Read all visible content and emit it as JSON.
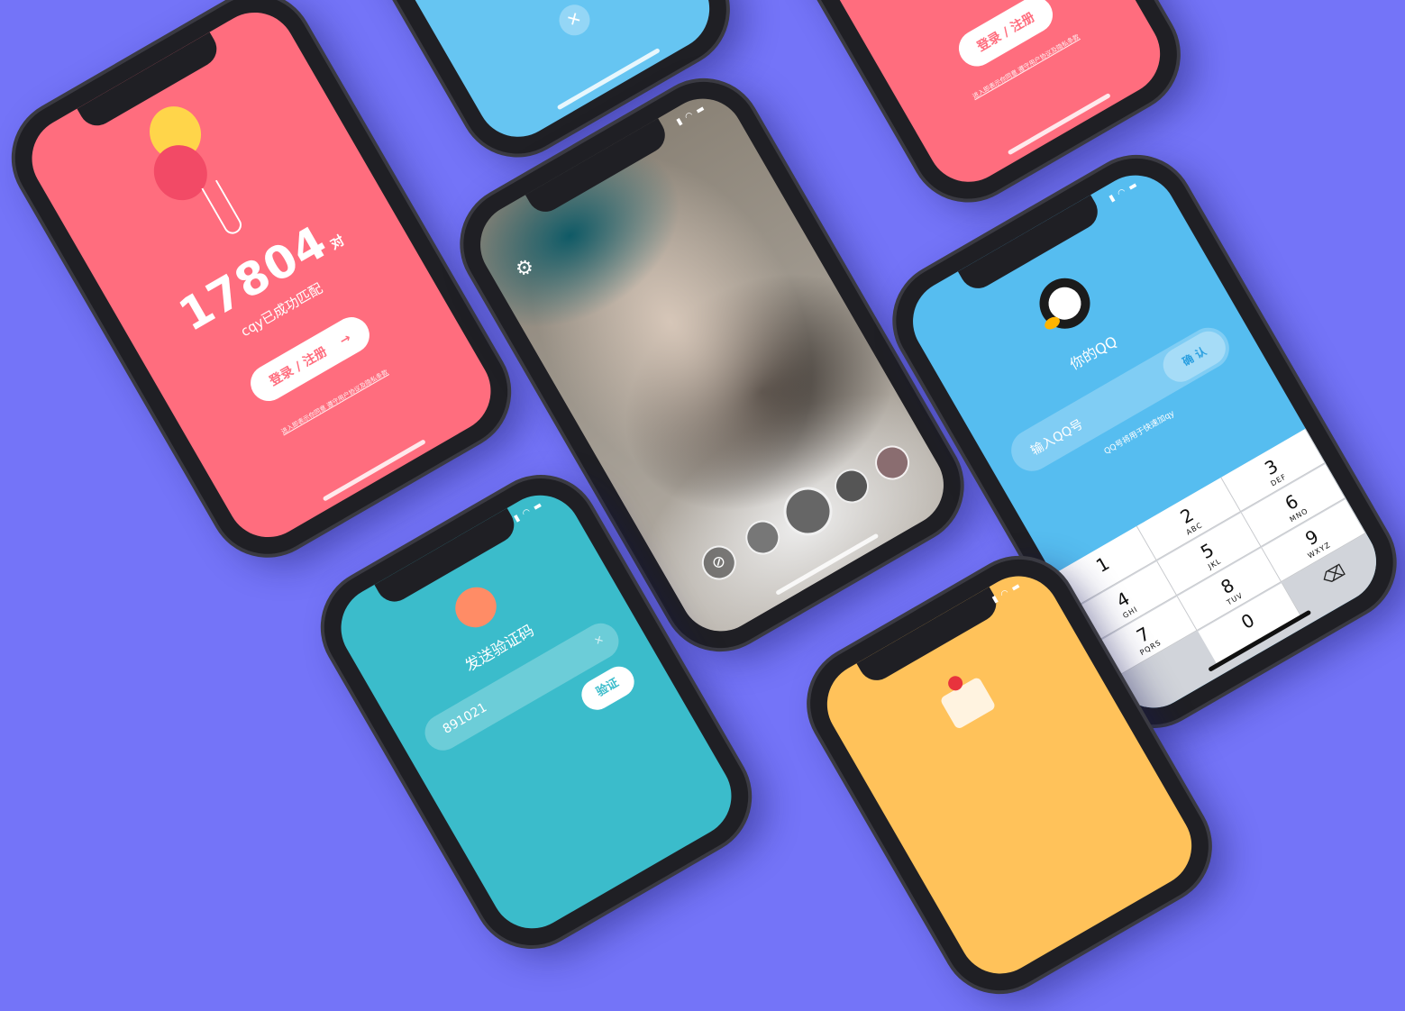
{
  "colors": {
    "background": "#7474f8",
    "pink": "#ff6d7e",
    "sky": "#66c5f2",
    "qq_blue": "#56bdf0",
    "teal": "#3bbccb",
    "yellow": "#ffc25a"
  },
  "pink_phone": {
    "count": "17804",
    "count_unit": "对",
    "subtitle": "cqy已成功匹配",
    "login_button": "登录 / 注册",
    "arrow_icon": "→",
    "terms_link": "进入即表示你同意 遵守用户协议及隐私条款"
  },
  "blue_top_phone": {
    "close_icon": "✕"
  },
  "pink_top_phone": {
    "login_button": "登录 / 注册",
    "terms_link": "进入即表示你同意 遵守用户协议及隐私条款"
  },
  "camera_phone": {
    "settings_icon": "⚙",
    "none_filter_icon": "⊘"
  },
  "qq_phone": {
    "title": "你的QQ",
    "input_placeholder": "输入QQ号",
    "confirm_button": "确 认",
    "hint": "QQ号将用于快速加qy",
    "keys": [
      {
        "digit": "1",
        "letters": ""
      },
      {
        "digit": "2",
        "letters": "ABC"
      },
      {
        "digit": "3",
        "letters": "DEF"
      },
      {
        "digit": "4",
        "letters": "GHI"
      },
      {
        "digit": "5",
        "letters": "JKL"
      },
      {
        "digit": "6",
        "letters": "MNO"
      },
      {
        "digit": "7",
        "letters": "PQRS"
      },
      {
        "digit": "8",
        "letters": "TUV"
      },
      {
        "digit": "9",
        "letters": "WXYZ"
      },
      {
        "digit": "0",
        "letters": ""
      }
    ],
    "backspace_icon": "⌫"
  },
  "teal_phone": {
    "title": "发送验证码",
    "phone_value": "891021",
    "clear_icon": "✕",
    "verify_button": "验证"
  }
}
